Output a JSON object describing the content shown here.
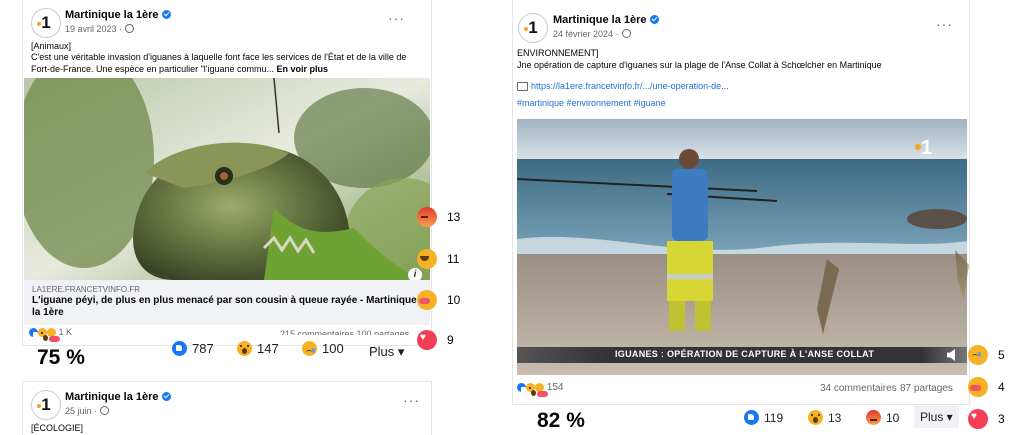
{
  "post1": {
    "page_name": "Martinique la 1ère",
    "date": "19 avril 2023 ·",
    "tag": "[Animaux]",
    "body": "C'est une véritable invasion d'iguanes à laquelle font face les services de l'État et de la ville de Fort-de-France. Une espèce en particulier \"l'iguane commu...",
    "see_more": "En voir plus",
    "link_domain": "LA1ERE.FRANCETVINFO.FR",
    "link_title": "L'iguane péyi, de plus en plus menacé par son cousin à queue rayée - Martinique la 1ère",
    "reactions_count": "1 K",
    "comments_shares": "215 commentaires  100 partages",
    "percent": "75 %",
    "stats": {
      "like": "787",
      "wow": "147",
      "sad": "100",
      "plus": "Plus ▾"
    },
    "side_stats": {
      "angry": "13",
      "haha": "11",
      "care": "10",
      "love": "9"
    }
  },
  "post2": {
    "page_name": "Martinique la 1ère",
    "date": "24 février 2024 ·",
    "tag": "ENVIRONNEMENT]",
    "body": "Jne opération de capture d'iguanes sur la plage de l'Anse Collat à Schœlcher en Martinique",
    "url": "https://la1ere.francetvinfo.fr/.../une-operation-de...",
    "hashtags": "#martinique #environnement #iguane",
    "banner": "IGUANES : OPÉRATION DE CAPTURE À L'ANSE COLLAT",
    "channel_logo": "1",
    "reactions_count": "154",
    "comments": "34 commentaires",
    "shares": "87 partages",
    "percent": "82 %",
    "stats": {
      "like": "119",
      "wow": "13",
      "angry": "10",
      "plus": "Plus ▾"
    },
    "side_stats": {
      "sad": "5",
      "care": "4",
      "love": "3"
    }
  },
  "post3": {
    "page_name": "Martinique la 1ère",
    "date": "25 juin ·",
    "tag": "[ÉCOLOGIE]"
  },
  "colors": {
    "facebook_blue": "#1877f2",
    "text_gray": "#65676b"
  }
}
